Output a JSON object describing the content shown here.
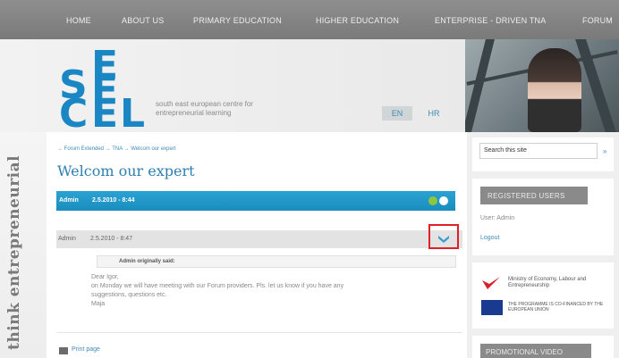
{
  "nav": {
    "items": [
      "HOME",
      "ABOUT US",
      "PRIMARY EDUCATION",
      "HIGHER EDUCATION",
      "ENTERPRISE - DRIVEN TNA",
      "FORUM"
    ]
  },
  "header": {
    "logo_letters": [
      "S",
      "E",
      "E",
      "C",
      "E",
      "L"
    ],
    "tagline": "south east european centre for entrepreneurial learning",
    "lang_en": "EN",
    "lang_hr": "HR"
  },
  "sidebar_left": {
    "vertical_text": "think entrepreneurial"
  },
  "main": {
    "breadcrumb": "→ Forum Extended → TNA → Welcom our expert",
    "title": "Welcom our expert",
    "post1": {
      "author": "Admin",
      "date": "2.5.2010 - 8:44"
    },
    "post2": {
      "author": "Admin",
      "date": "2.5.2010 - 8:47"
    },
    "quote_header": "Admin originally said:",
    "body_lines": [
      "Dear Igor,",
      "on Monday we will have meeting with our Forum providers. Pls. let us know if you have any",
      "suggestions, questions etc.",
      "Maja"
    ],
    "print_label": "Print page"
  },
  "right": {
    "search_value": "Search this site",
    "search_button": "»",
    "registered_users": "REGISTERED USERS",
    "user_text": "User: Admin",
    "logout": "Logout",
    "ministry_text": "Ministry of Economy, Labour and Entrepreneurship",
    "eu_text": "THE PROGRAMME IS CO-FINANCED BY THE EUROPEAN UNION",
    "promo_head": "PROMOTIONAL VIDEO"
  },
  "colors": {
    "accent": "#1a8cbe",
    "highlight": "#e01f26"
  }
}
